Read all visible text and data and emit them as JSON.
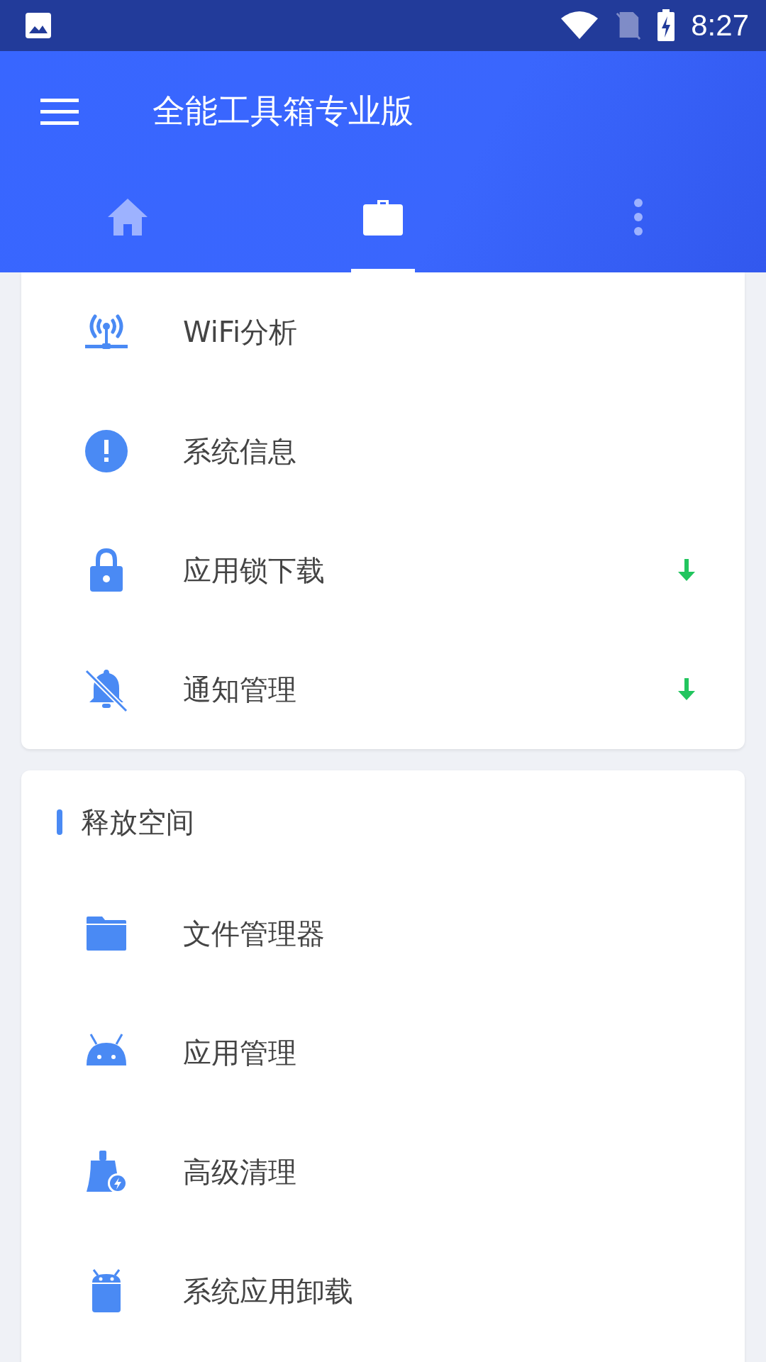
{
  "status_bar": {
    "time": "8:27"
  },
  "app_bar": {
    "title": "全能工具箱专业版"
  },
  "tabs": [
    {
      "selected": false
    },
    {
      "selected": true
    },
    {
      "selected": false
    }
  ],
  "sections": [
    {
      "items": [
        {
          "label": "WiFi分析",
          "download": false
        },
        {
          "label": "系统信息",
          "download": false
        },
        {
          "label": "应用锁下载",
          "download": true
        },
        {
          "label": "通知管理",
          "download": true
        }
      ]
    },
    {
      "title": "释放空间",
      "items": [
        {
          "label": "文件管理器",
          "download": false
        },
        {
          "label": "应用管理",
          "download": false
        },
        {
          "label": "高级清理",
          "download": false
        },
        {
          "label": "系统应用卸载",
          "download": false
        }
      ]
    }
  ]
}
